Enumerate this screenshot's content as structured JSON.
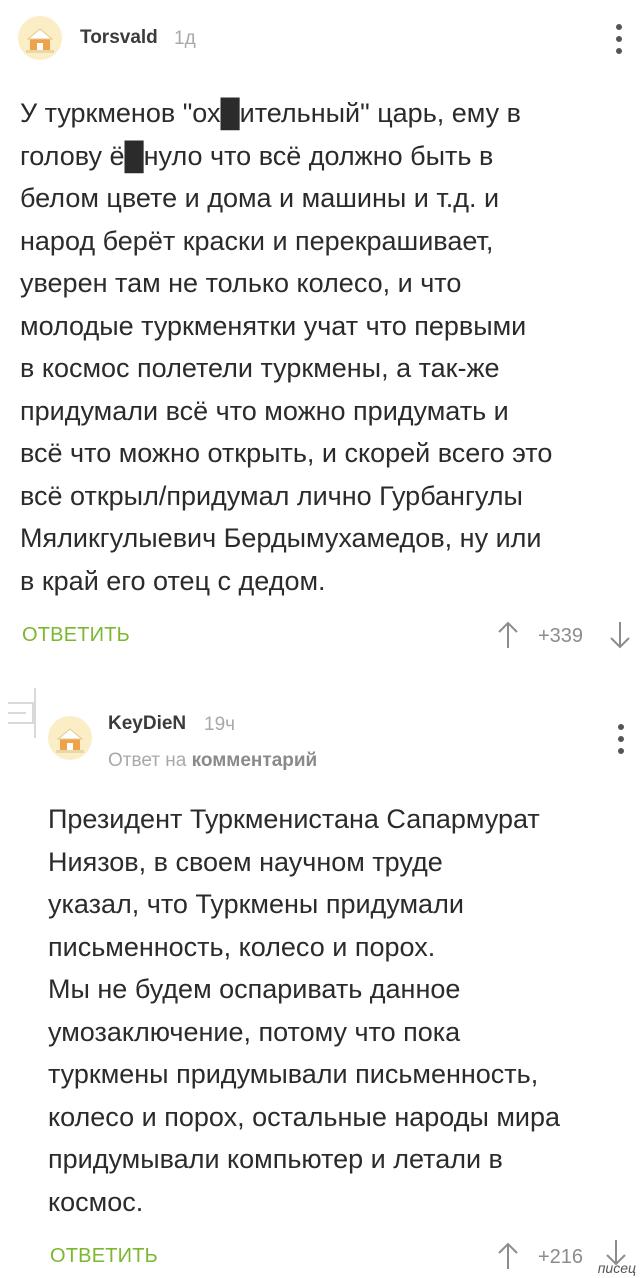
{
  "comment1": {
    "author": "Torsvald",
    "time": "1д",
    "lines": [
      "У туркменов \"ох█ительный\" царь, ему в",
      "голову ё█нуло что всё должно быть в",
      "белом цвете и дома и машины и т.д. и",
      "народ берёт краски и перекрашивает,",
      "уверен там не только колесо, и что",
      "молодые туркменятки учат что первыми",
      "в космос  полетели туркмены, а так-же",
      "придумали  всё что можно придумать и",
      "всё что можно открыть, и скорей всего это",
      "всё открыл/придумал лично Гурбангулы",
      "Мяликгулыевич Бердымухамедов, ну или",
      "в край его отец с дедом."
    ],
    "reply_label": "ОТВЕТИТЬ",
    "score": "+339"
  },
  "comment2": {
    "author": "KeyDieN",
    "time": "19ч",
    "answer_prefix": "Ответ на",
    "answer_target": "комментарий",
    "lines": [
      "Президент Туркменистана Сапармурат",
      "Ниязов, в своем научном труде",
      "указал, что Туркмены придумали",
      "письменность, колесо и порох.",
      "Мы не будем оспаривать данное",
      "умозаключение, потому что пока",
      "туркмены придумывали письменность,",
      "колесо и порох, остальные народы мира",
      "придумывали компьютер и летали в",
      "космос."
    ],
    "reply_label": "ОТВЕТИТЬ",
    "score": "+216"
  },
  "icons": {
    "avatar": "default-avatar-icon",
    "menu": "kebab-menu-icon",
    "upvote": "arrow-up-icon",
    "downvote": "arrow-down-icon",
    "collapse": "collapse-thread-icon"
  },
  "colors": {
    "accent": "#7bb72f",
    "text": "#2b2b2b",
    "muted": "#a9a9a9"
  },
  "watermark": "писец"
}
